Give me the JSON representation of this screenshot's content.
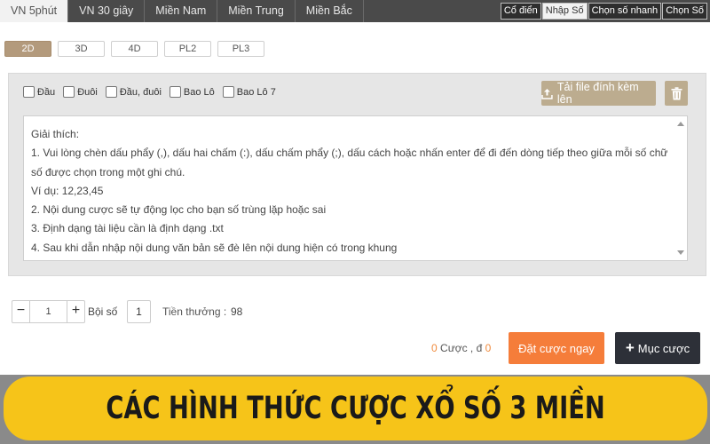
{
  "nav": {
    "region_tabs": [
      "VN 5phút",
      "VN 30 giây",
      "Miền Nam",
      "Miền Trung",
      "Miền Bắc"
    ],
    "active_region": "VN 5phút",
    "mode_tabs": [
      "Cổ điển",
      "Nhập Số",
      "Chọn số nhanh",
      "Chọn Số"
    ],
    "active_mode": "Nhập Số"
  },
  "game_types": [
    "2D",
    "3D",
    "4D",
    "PL2",
    "PL3"
  ],
  "active_game_type": "2D",
  "positions": [
    "Đầu",
    "Đuôi",
    "Đầu, đuôi",
    "Bao Lô",
    "Bao Lô 7"
  ],
  "upload": {
    "label": "Tải file đính kèm lên",
    "icon": "upload-icon"
  },
  "trash": {
    "icon": "trash-icon"
  },
  "instructions": [
    "Giải thích:",
    "1. Vui lòng chèn dấu phẩy (,), dấu hai chấm (:), dấu chấm phẩy (;), dấu cách hoặc nhấn enter để đi đến dòng tiếp theo giữa mỗi số chữ số được chọn trong một ghi chú.",
    "Ví dụ: 12,23,45",
    "2. Nội dung cược sẽ tự động lọc cho bạn số trùng lặp hoặc sai",
    "3. Định dạng tài liệu cần là định dạng .txt",
    "4. Sau khi dẫn nhập nội dung văn bản sẽ đè lên nội dung hiện có trong khung"
  ],
  "bet": {
    "stepper_value": "1",
    "minus": "−",
    "plus": "+",
    "multiplier_label": "Bội số",
    "multiplier_value": "1",
    "prize_label": "Tiền thưởng :",
    "prize_value": "98"
  },
  "summary": {
    "count": "0",
    "count_label": "Cược ,",
    "currency": "đ",
    "amount": "0"
  },
  "actions": {
    "place_bet": "Đặt cược ngay",
    "add_bet": "Mục cược",
    "add_icon": "plus-icon"
  },
  "banner": {
    "text": "CÁC HÌNH THỨC CƯỢC XỔ SỐ 3 MIỀN"
  },
  "colors": {
    "nav_bg": "#4a4a4a",
    "accent_tan": "#bcac8f",
    "orange": "#f57d3a",
    "dark_button": "#2d3038",
    "banner_yellow": "#f6c419"
  }
}
